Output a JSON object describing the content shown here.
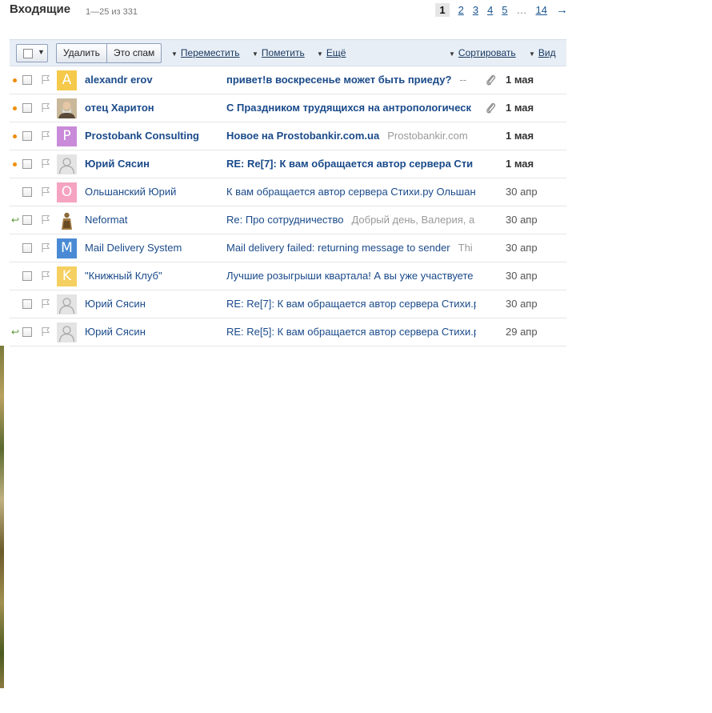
{
  "header": {
    "title": "Входящие",
    "count": "1—25 из 331"
  },
  "pager": {
    "current": "1",
    "pages": [
      "2",
      "3",
      "4",
      "5"
    ],
    "dots": "…",
    "last": "14",
    "next": "→"
  },
  "toolbar": {
    "delete_label": "Удалить",
    "spam_label": "Это спам",
    "move_label": "Переместить",
    "mark_label": "Пометить",
    "more_label": "Ещё",
    "sort_label": "Сортировать",
    "view_label": "Вид"
  },
  "colors": {
    "accent_link": "#1a4a8a",
    "unread_dot": "#f08c00",
    "reply": "#5a9a3a",
    "toolbar_bg": "#e8eef6"
  },
  "messages": [
    {
      "status": "unread",
      "avatar_type": "letter",
      "avatar_letter": "A",
      "avatar_color": "#f5c94a",
      "sender": "alexandr erov",
      "subject": "привет!в воскресенье может быть приеду?",
      "snippet": "--",
      "attachment": true,
      "date": "1 мая",
      "unread": true
    },
    {
      "status": "unread",
      "avatar_type": "photo-man",
      "avatar_letter": "",
      "avatar_color": "",
      "sender": "отец Харитон",
      "subject": "С Праздником трудящихся на антропологическ",
      "snippet": "",
      "attachment": true,
      "date": "1 мая",
      "unread": true
    },
    {
      "status": "unread",
      "avatar_type": "letter",
      "avatar_letter": "P",
      "avatar_color": "#c98ad9",
      "sender": "Prostobank Consulting",
      "subject": "Новое на Prostobankir.com.ua",
      "snippet": "Prostobankir.com",
      "attachment": false,
      "date": "1 мая",
      "unread": true
    },
    {
      "status": "unread",
      "avatar_type": "placeholder",
      "avatar_letter": "",
      "avatar_color": "",
      "sender": "Юрий Сясин",
      "subject": "RE: Re[7]: К вам обращается автор сервера Сти",
      "snippet": "",
      "attachment": false,
      "date": "1 мая",
      "unread": true
    },
    {
      "status": "none",
      "avatar_type": "letter",
      "avatar_letter": "O",
      "avatar_color": "#f5a3c0",
      "sender": "Ольшанский Юрий",
      "subject": "К вам обращается автор сервера Стихи.ру Ольшан",
      "snippet": "",
      "attachment": false,
      "date": "30 апр",
      "unread": false
    },
    {
      "status": "replied",
      "avatar_type": "photo-figure",
      "avatar_letter": "",
      "avatar_color": "",
      "sender": "Neformat",
      "subject": "Re: Про сотрудничество",
      "snippet": "Добрый день, Валерия, а",
      "attachment": false,
      "date": "30 апр",
      "unread": false
    },
    {
      "status": "none",
      "avatar_type": "letter",
      "avatar_letter": "M",
      "avatar_color": "#4a8ad4",
      "sender": "Mail Delivery System",
      "subject": "Mail delivery failed: returning message to sender",
      "snippet": "Thi",
      "attachment": false,
      "date": "30 апр",
      "unread": false
    },
    {
      "status": "none",
      "avatar_type": "letter",
      "avatar_letter": "K",
      "avatar_color": "#f5d060",
      "sender": "\"Книжный Клуб\"",
      "subject": "Лучшие розыгрыши квартала! А вы уже участвуете",
      "snippet": "",
      "attachment": false,
      "date": "30 апр",
      "unread": false
    },
    {
      "status": "none",
      "avatar_type": "placeholder",
      "avatar_letter": "",
      "avatar_color": "",
      "sender": "Юрий Сясин",
      "subject": "RE: Re[7]: К вам обращается автор сервера Стихи.р",
      "snippet": "",
      "attachment": false,
      "date": "30 апр",
      "unread": false
    },
    {
      "status": "replied",
      "avatar_type": "placeholder",
      "avatar_letter": "",
      "avatar_color": "",
      "sender": "Юрий Сясин",
      "subject": "RE: Re[5]: К вам обращается автор сервера Стихи.р",
      "snippet": "",
      "attachment": false,
      "date": "29 апр",
      "unread": false
    }
  ]
}
